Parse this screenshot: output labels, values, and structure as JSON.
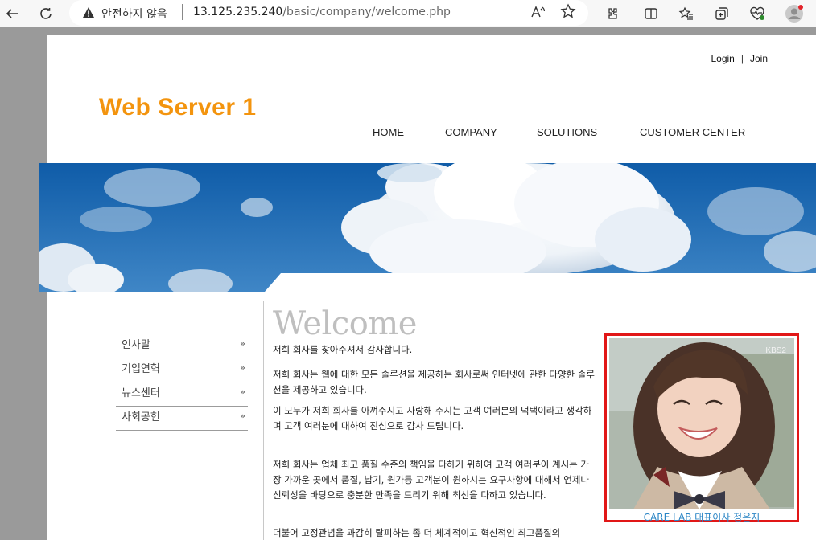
{
  "browser": {
    "security_text": "안전하지 않음",
    "url_host": "13.125.235.240",
    "url_path": "/basic/company/welcome.php",
    "read_aloud_label": "Aᴾ"
  },
  "header": {
    "login": "Login",
    "separator": "|",
    "join": "Join",
    "logo": "Web Server 1"
  },
  "nav": [
    "HOME",
    "COMPANY",
    "SOLUTIONS",
    "CUSTOMER CENTER"
  ],
  "side_menu": [
    {
      "label": "인사말",
      "arrow": "»"
    },
    {
      "label": "기업연혁",
      "arrow": "»"
    },
    {
      "label": "뉴스센터",
      "arrow": "»"
    },
    {
      "label": "사회공헌",
      "arrow": "»"
    }
  ],
  "content": {
    "heading": "Welcome",
    "p1": "저희 회사를 찾아주셔서 감사합니다.",
    "p2": "저희 회사는 웹에 대한 모든 솔루션을 제공하는 회사로써 인터넷에 관한 다양한 솔루션을 제공하고 있습니다.",
    "p3": "이 모두가 저희 회사를 아껴주시고 사랑해 주시는 고객 여러분의 덕택이라고 생각하며 고객 여러분에 대하여 진심으로 감사 드립니다.",
    "p4": "저희 회사는 업체 최고 품질 수준의 책임을 다하기 위하여 고객 여러분이 계시는 가장 가까운 곳에서 품질, 납기, 원가등 고객분이 원하시는 요구사항에 대해서 언제나 신뢰성을 바탕으로 충분한 만족을 드리기 위해 최선을 다하고 있습니다.",
    "p5": "더불어 고정관념을 과감히 탈피하는 좀 더 체계적이고 혁신적인 최고품질의"
  },
  "photo": {
    "watermark": "KBS2",
    "caption": "CARE LAB 대표이사 정은지"
  },
  "colors": {
    "logo": "#f3940e",
    "sky": "#1f6ab0",
    "caption": "#2a85c5",
    "highlight_border": "#e11717"
  }
}
